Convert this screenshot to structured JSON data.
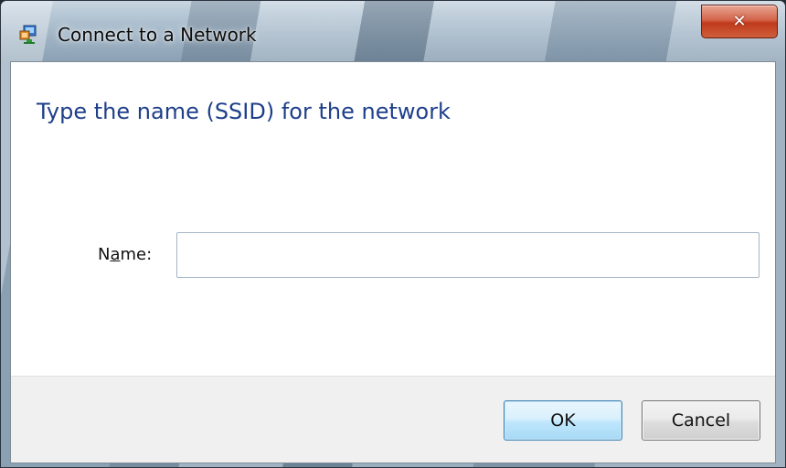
{
  "window": {
    "title": "Connect to a Network",
    "app_icon": "network-icon",
    "close_icon": "close-icon",
    "close_glyph": "✕"
  },
  "main": {
    "instruction": "Type the name (SSID) for the network",
    "name_label": {
      "before": "N",
      "accel": "a",
      "after": "me:"
    },
    "name_value": ""
  },
  "footer": {
    "ok_label": "OK",
    "cancel_label": "Cancel"
  },
  "colors": {
    "instruction_text": "#1e3f8a",
    "ok_border": "#3c7fb1",
    "close_button": "#c8452a"
  }
}
